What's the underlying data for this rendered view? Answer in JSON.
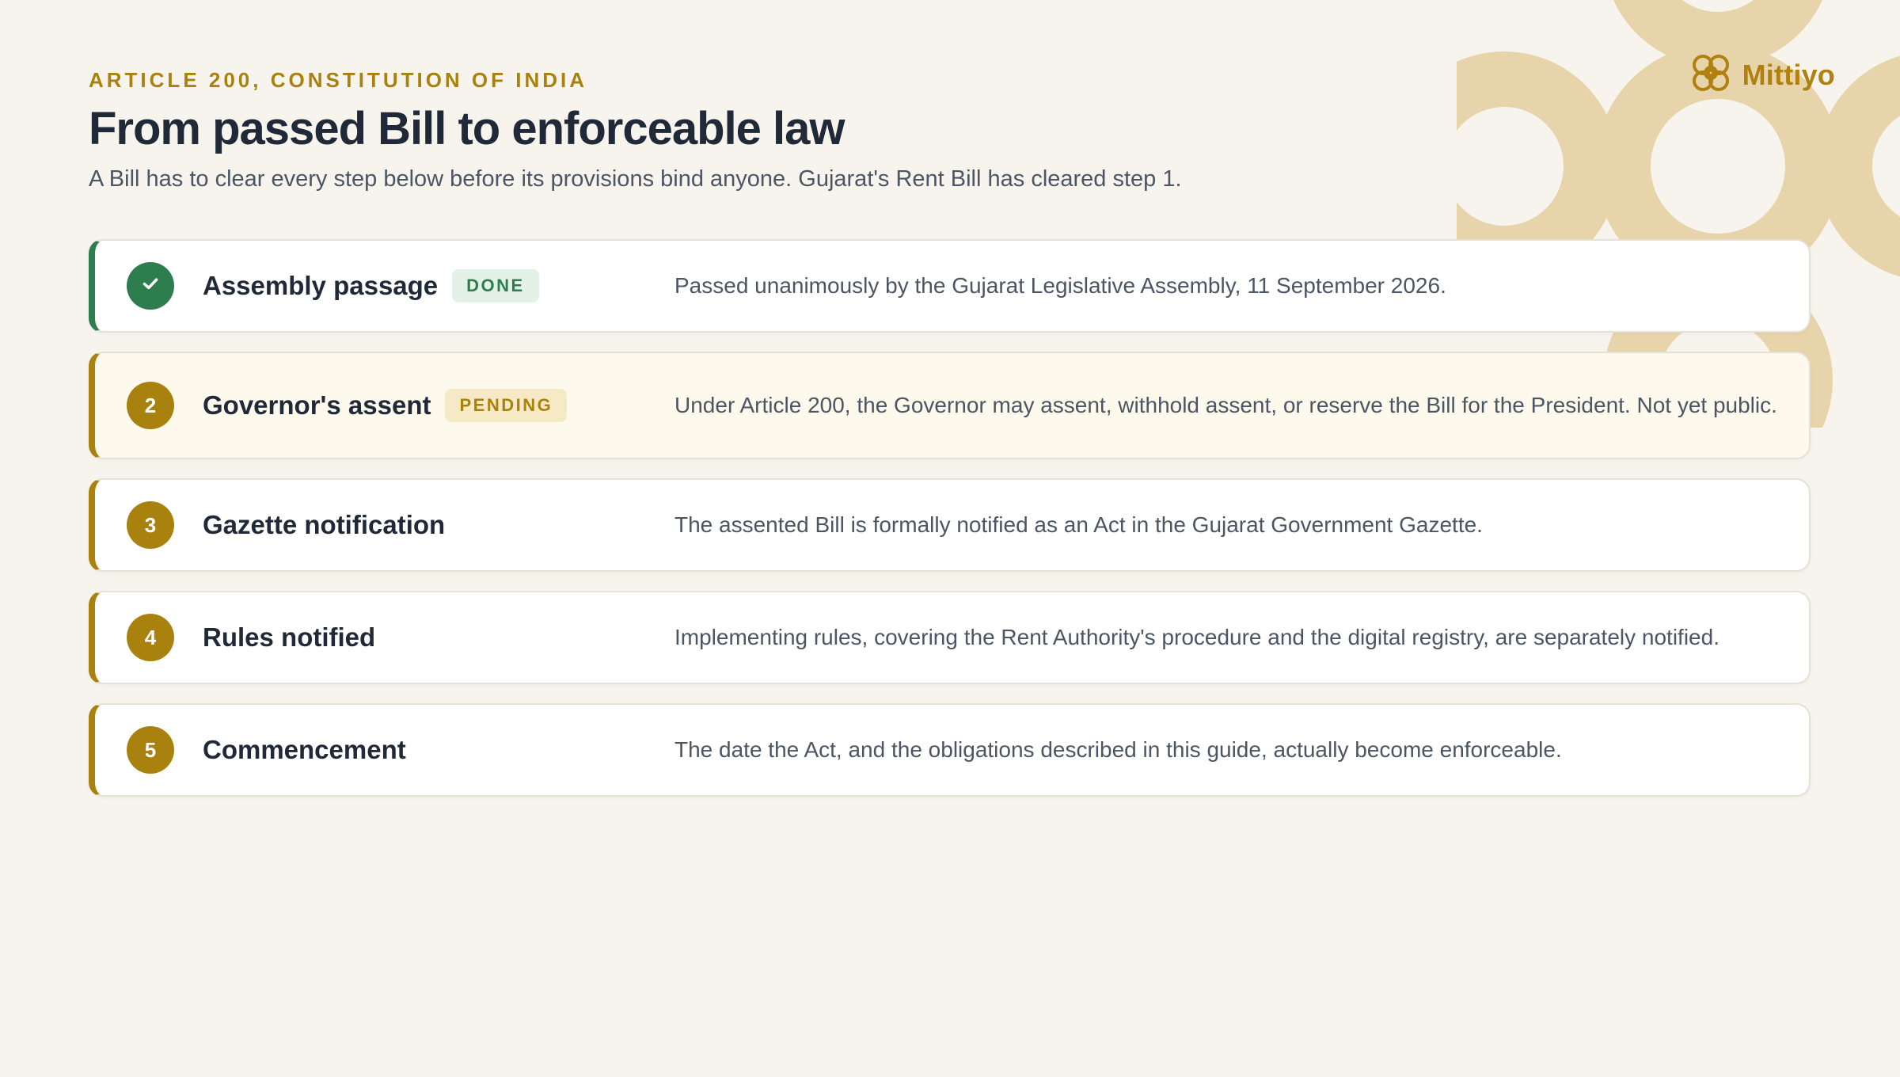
{
  "brand": {
    "name": "Mittiyo",
    "color": "#b08010"
  },
  "header": {
    "eyebrow": "ARTICLE 200, CONSTITUTION OF INDIA",
    "title": "From passed Bill to enforceable law",
    "subtitle": "A Bill has to clear every step below before its provisions bind anyone. Gujarat's Rent Bill has cleared step 1."
  },
  "colors": {
    "accent": "#a9810e",
    "done": "#2e7d4f",
    "background": "#f7f4ee"
  },
  "steps": [
    {
      "marker": "check-icon",
      "title": "Assembly passage",
      "status": "DONE",
      "description": "Passed unanimously by the Gujarat Legislative Assembly, 11 September 2026."
    },
    {
      "marker": "2",
      "title": "Governor's assent",
      "status": "PENDING",
      "description": "Under Article 200, the Governor may assent, withhold assent, or reserve the Bill for the President. Not yet public."
    },
    {
      "marker": "3",
      "title": "Gazette notification",
      "status": "",
      "description": "The assented Bill is formally notified as an Act in the Gujarat Government Gazette."
    },
    {
      "marker": "4",
      "title": "Rules notified",
      "status": "",
      "description": "Implementing rules, covering the Rent Authority's procedure and the digital registry, are separately notified."
    },
    {
      "marker": "5",
      "title": "Commencement",
      "status": "",
      "description": "The date the Act, and the obligations described in this guide, actually become enforceable."
    }
  ]
}
